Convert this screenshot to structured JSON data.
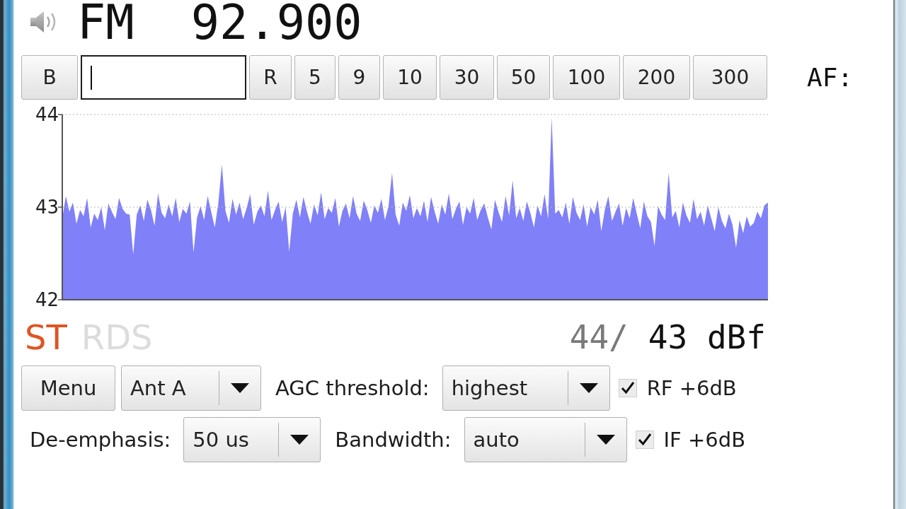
{
  "header": {
    "band": "FM",
    "frequency": "92.900"
  },
  "tuning_bar": {
    "items": [
      {
        "kind": "button",
        "label": "B"
      },
      {
        "kind": "input",
        "focused": true
      },
      {
        "kind": "button",
        "label": "R"
      },
      {
        "kind": "button",
        "label": "5"
      },
      {
        "kind": "button",
        "label": "9"
      },
      {
        "kind": "button",
        "label": "10"
      },
      {
        "kind": "button",
        "label": "30"
      },
      {
        "kind": "button",
        "label": "50"
      },
      {
        "kind": "button",
        "label": "100"
      },
      {
        "kind": "button",
        "label": "200"
      },
      {
        "kind": "button",
        "label": "300"
      }
    ],
    "af_label": "AF:"
  },
  "chart": {
    "chart_data": {
      "type": "area",
      "color": "#8080f8",
      "ylim": [
        42,
        44
      ],
      "yticks": [
        42,
        43,
        44
      ],
      "tick_labels": "y",
      "grid": true,
      "values": [
        42.88,
        43.12,
        42.95,
        43.05,
        42.82,
        42.97,
        42.9,
        43.1,
        42.78,
        42.93,
        42.86,
        43.0,
        42.75,
        43.04,
        42.95,
        42.87,
        43.1,
        42.98,
        42.93,
        42.92,
        42.49,
        42.92,
        43.02,
        42.85,
        43.08,
        42.97,
        42.8,
        43.15,
        42.94,
        42.88,
        43.03,
        42.9,
        43.1,
        42.84,
        42.98,
        42.93,
        43.06,
        42.51,
        42.89,
        43.01,
        42.86,
        43.12,
        42.95,
        42.78,
        43.04,
        43.46,
        42.96,
        42.83,
        43.09,
        42.92,
        43.05,
        42.87,
        42.99,
        43.14,
        42.81,
        42.95,
        43.02,
        42.9,
        43.18,
        42.86,
        42.97,
        43.06,
        42.84,
        43.0,
        42.52,
        42.93,
        43.08,
        42.89,
        43.11,
        42.95,
        42.82,
        43.03,
        42.91,
        43.16,
        42.87,
        42.99,
        42.94,
        43.1,
        42.79,
        42.96,
        43.04,
        42.88,
        43.12,
        42.93,
        42.85,
        43.07,
        42.97,
        42.83,
        43.02,
        42.94,
        43.09,
        42.86,
        43.01,
        43.37,
        42.92,
        42.8,
        43.05,
        42.96,
        43.13,
        42.88,
        42.99,
        42.9,
        43.07,
        42.84,
        43.11,
        42.95,
        42.82,
        43.03,
        42.92,
        43.15,
        42.87,
        42.98,
        43.06,
        42.81,
        43.0,
        42.93,
        43.1,
        42.86,
        42.97,
        43.04,
        42.89,
        42.76,
        43.08,
        42.95,
        42.84,
        43.12,
        42.91,
        43.29,
        42.88,
        42.99,
        42.85,
        43.06,
        42.94,
        42.78,
        43.02,
        42.9,
        43.14,
        42.87,
        43.97,
        42.93,
        42.97,
        42.89,
        43.05,
        42.82,
        43.11,
        42.94,
        42.86,
        43.03,
        42.79,
        43.0,
        42.92,
        43.08,
        42.74,
        42.97,
        43.12,
        42.85,
        42.95,
        43.04,
        42.8,
        42.99,
        42.88,
        43.1,
        42.93,
        42.77,
        43.06,
        42.9,
        42.84,
        42.58,
        43.01,
        42.92,
        42.86,
        43.37,
        42.89,
        42.96,
        42.78,
        43.05,
        42.91,
        42.83,
        43.09,
        42.87,
        42.95,
        42.8,
        43.02,
        42.88,
        42.74,
        43.0,
        42.85,
        42.77,
        42.93,
        42.81,
        42.56,
        42.86,
        42.72,
        42.9,
        42.79,
        42.83,
        42.95,
        42.88,
        43.02,
        43.05
      ]
    }
  },
  "status": {
    "indicators": [
      {
        "label": "ST",
        "on": true
      },
      {
        "label": "RDS",
        "on": false
      }
    ],
    "signal_reading": {
      "peak": "44/",
      "current": "43 dBf"
    }
  },
  "controls": {
    "rows": [
      {
        "items": [
          {
            "kind": "button",
            "label": "Menu"
          },
          {
            "kind": "dropdown",
            "value": "Ant A"
          },
          {
            "kind": "label",
            "text": "AGC threshold:"
          },
          {
            "kind": "dropdown",
            "value": "highest"
          },
          {
            "kind": "checkbox",
            "label": "RF +6dB",
            "checked": true
          }
        ]
      },
      {
        "items": [
          {
            "kind": "label",
            "text": "De-emphasis:"
          },
          {
            "kind": "dropdown",
            "value": "50 us"
          },
          {
            "kind": "label",
            "text": "Bandwidth:"
          },
          {
            "kind": "dropdown",
            "value": "auto"
          },
          {
            "kind": "checkbox",
            "label": "IF +6dB",
            "checked": true
          }
        ]
      }
    ]
  }
}
